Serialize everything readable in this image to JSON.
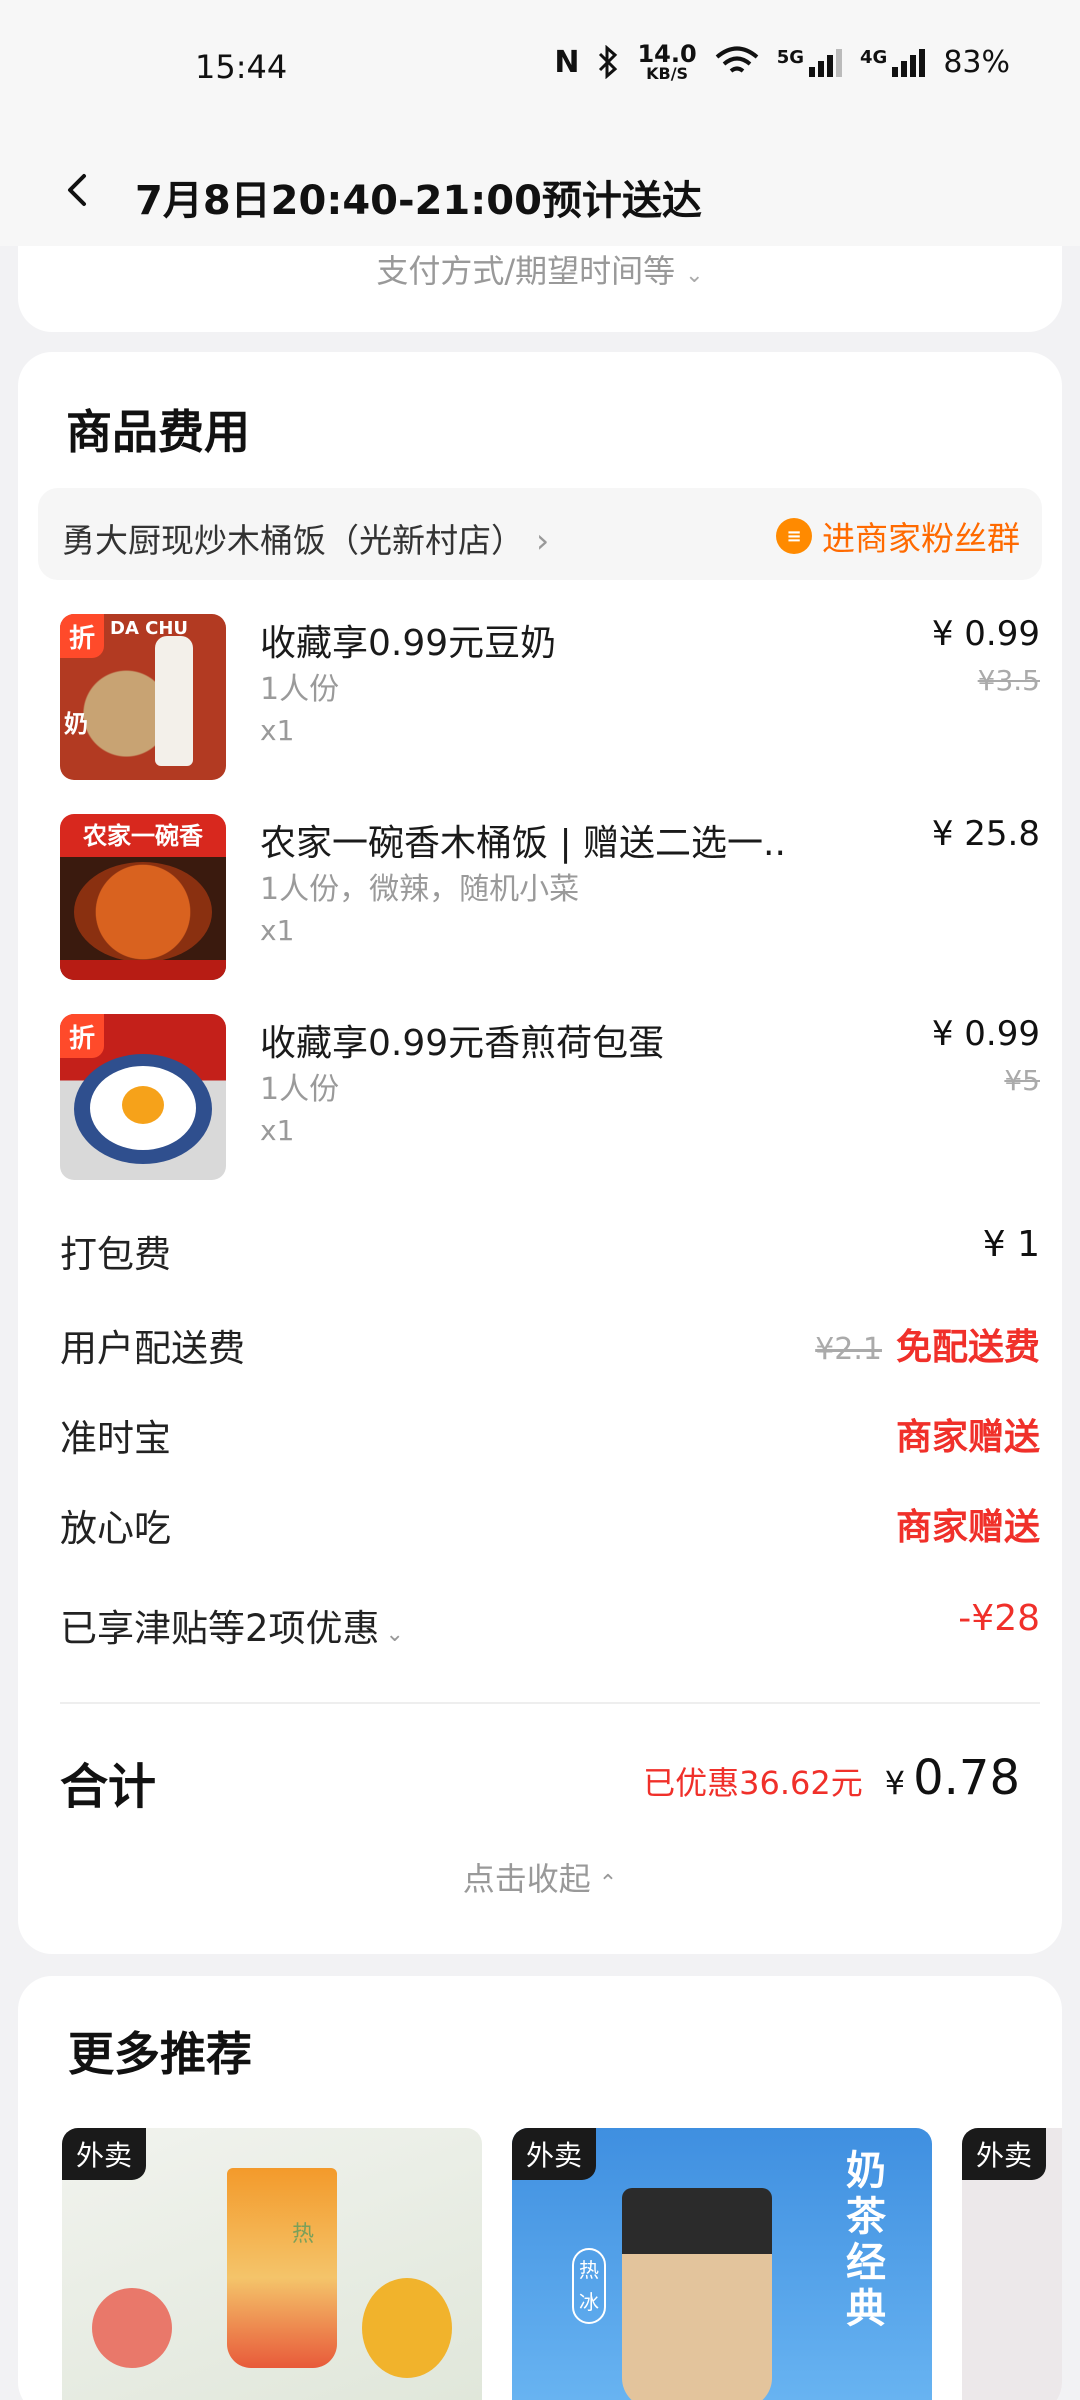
{
  "status_bar": {
    "time": "15:44",
    "net_speed": "14.0",
    "net_unit": "KB/S",
    "signal_5g": "5G",
    "signal_4g": "4G",
    "battery": "83%"
  },
  "header": {
    "title": "7月8日20:40-21:00预计送达"
  },
  "payment_card": {
    "expand_label": "支付方式/期望时间等"
  },
  "fees_card": {
    "title": "商品费用",
    "store": {
      "name": "勇大厨现炒木桶饭（光新村店）",
      "fan_group_label": "进商家粉丝群"
    },
    "items": [
      {
        "name": "收藏享0.99元豆奶",
        "spec": "1人份",
        "qty": "x1",
        "price": "¥ 0.99",
        "original_price": "¥3.5",
        "tag": "折",
        "thumb_brand": "DA CHU",
        "thumb_side": "奶"
      },
      {
        "name": "农家一碗香木桶饭 | 赠送二选一..",
        "spec": "1人份，微辣，随机小菜",
        "qty": "x1",
        "price": "¥ 25.8",
        "original_price": "",
        "thumb_banner": "农家一碗香"
      },
      {
        "name": "收藏享0.99元香煎荷包蛋",
        "spec": "1人份",
        "qty": "x1",
        "price": "¥ 0.99",
        "original_price": "¥5",
        "tag": "折"
      }
    ],
    "fees": [
      {
        "label": "打包费",
        "value": "¥ 1"
      },
      {
        "label": "用户配送费",
        "strike": "¥2.1",
        "value": "免配送费"
      },
      {
        "label": "准时宝",
        "value": "商家赠送"
      },
      {
        "label": "放心吃",
        "value": "商家赠送"
      },
      {
        "label": "已享津贴等2项优惠",
        "value": "-¥28"
      }
    ],
    "total_label": "合计",
    "saved_label": "已优惠36.62元",
    "total_currency": "¥",
    "total_amount": "0.78",
    "collapse_label": "点击收起"
  },
  "recommendations": {
    "title": "更多推荐",
    "cards": [
      {
        "tag": "外卖",
        "hot_label": "热"
      },
      {
        "tag": "外卖",
        "slogan": "奶茶经典",
        "hot": "热",
        "cold": "冰"
      },
      {
        "tag": "外卖"
      }
    ]
  },
  "colors": {
    "accent_red": "#f0302a",
    "accent_orange": "#ff6a00",
    "background": "#f2f2f4"
  }
}
